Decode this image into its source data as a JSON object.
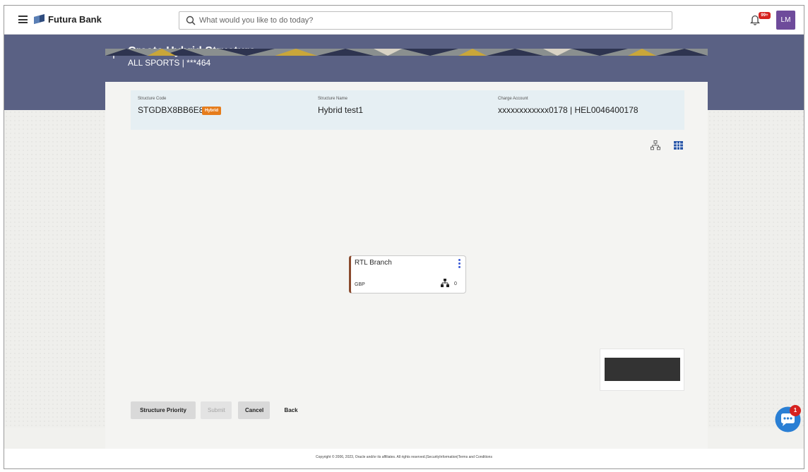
{
  "app": {
    "brand": "Futura Bank"
  },
  "search": {
    "placeholder": "What would you like to do today?"
  },
  "notifications": {
    "badge": "99+"
  },
  "user": {
    "initials": "LM"
  },
  "page": {
    "title": "Create Hybrid Structure",
    "subtitle": "ALL SPORTS | ***464"
  },
  "structure": {
    "code_label": "Structure Code",
    "code": "STGDBX8BB6E8",
    "type_badge": "Hybrid",
    "name_label": "Structure Name",
    "name": "Hybrid test1",
    "charge_label": "Charge Account",
    "charge": "xxxxxxxxxxxx0178 | HEL0046400178"
  },
  "node": {
    "title": "RTL Branch",
    "currency": "GBP",
    "child_count": "0"
  },
  "actions": {
    "priority": "Structure Priority",
    "submit": "Submit",
    "cancel": "Cancel",
    "back": "Back"
  },
  "footer": {
    "text": "Copyright © 2006, 2023, Oracle and/or its affiliates. All rights reserved.|SecurityInformation|Terms and Conditions"
  },
  "chat": {
    "badge": "1"
  },
  "colors": {
    "header_band": "#5a6184",
    "hybrid_badge": "#e67c1b",
    "accent": "#3b5bd6",
    "node_border": "#8a4a2e"
  }
}
